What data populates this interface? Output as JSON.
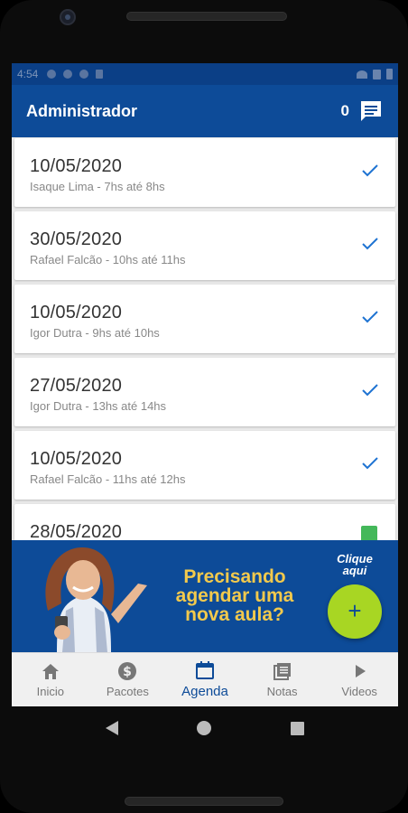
{
  "status": {
    "time": "4:54"
  },
  "header": {
    "title": "Administrador",
    "message_count": "0"
  },
  "appointments": [
    {
      "date": "10/05/2020",
      "detail": "Isaque Lima - 7hs até 8hs",
      "status": "check-icon"
    },
    {
      "date": "30/05/2020",
      "detail": "Rafael Falcão - 10hs até 11hs",
      "status": "check-icon"
    },
    {
      "date": "10/05/2020",
      "detail": "Igor Dutra - 9hs até 10hs",
      "status": "check-icon"
    },
    {
      "date": "27/05/2020",
      "detail": "Igor Dutra - 13hs até 14hs",
      "status": "check-icon"
    },
    {
      "date": "10/05/2020",
      "detail": "Rafael Falcão - 11hs até 12hs",
      "status": "check-icon"
    },
    {
      "date": "28/05/2020",
      "detail": "",
      "status": "green-checkbox-icon"
    }
  ],
  "banner": {
    "headline": "Precisando agendar uma nova aula?",
    "cta_hint": "Clique aqui",
    "fab_label": "+"
  },
  "bottom_nav": [
    {
      "label": "Inicio",
      "icon": "home-icon"
    },
    {
      "label": "Pacotes",
      "icon": "dollar-icon"
    },
    {
      "label": "Agenda",
      "icon": "calendar-icon",
      "active": true
    },
    {
      "label": "Notas",
      "icon": "notes-icon"
    },
    {
      "label": "Videos",
      "icon": "play-icon"
    }
  ],
  "colors": {
    "primary": "#0d4b98",
    "accent": "#a8d623",
    "headline": "#f2c94c",
    "check": "#1e73d2"
  }
}
